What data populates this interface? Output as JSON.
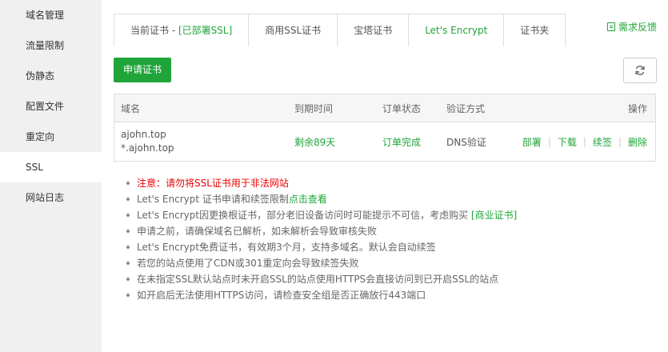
{
  "sidebar": {
    "items": [
      {
        "label": "域名管理"
      },
      {
        "label": "流量限制"
      },
      {
        "label": "伪静态"
      },
      {
        "label": "配置文件"
      },
      {
        "label": "重定向"
      },
      {
        "label": "SSL"
      },
      {
        "label": "网站日志"
      }
    ],
    "active": "SSL"
  },
  "tabs": {
    "current_prefix": "当前证书 - ",
    "current_status": "[已部署SSL]",
    "commercial": "商用SSL证书",
    "baota": "宝塔证书",
    "letsencrypt": "Let's Encrypt",
    "folder": "证书夹",
    "active": "Let's Encrypt"
  },
  "feedback": {
    "label": "需求反馈",
    "icon": "form-icon"
  },
  "toolbar": {
    "apply_label": "申请证书",
    "refresh_icon": "refresh-icon"
  },
  "table": {
    "headers": {
      "domain": "域名",
      "expire": "到期时间",
      "order_status": "订单状态",
      "verify": "验证方式",
      "actions": "操作"
    },
    "rows": [
      {
        "domain_1": "ajohn.top",
        "domain_2": "*.ajohn.top",
        "expire": "剩余89天",
        "order_status": "订单完成",
        "verify": "DNS验证",
        "actions": {
          "deploy": "部署",
          "download": "下载",
          "renew": "续签",
          "delete": "删除"
        }
      }
    ]
  },
  "tips": {
    "t1": "注意：请勿将SSL证书用于非法网站",
    "t2_text": "Let's Encrypt 证书申请和续签限制",
    "t2_link": "点击查看",
    "t3_text": "Let's Encrypt因更换根证书，部分老旧设备访问时可能提示不可信，考虑购买 ",
    "t3_link": "[商业证书]",
    "t4": "申请之前，请确保域名已解析，如未解析会导致审核失败",
    "t5": "Let's Encrypt免费证书，有效期3个月，支持多域名。默认会自动续签",
    "t6": "若您的站点使用了CDN或301重定向会导致续签失败",
    "t7": "在未指定SSL默认站点时未开启SSL的站点使用HTTPS会直接访问到已开启SSL的站点",
    "t8": "如开启后无法使用HTTPS访问，请检查安全组是否正确放行443端口"
  },
  "colors": {
    "accent": "#20a53a",
    "warning": "#e00000",
    "sidebar_bg": "#f0f0f0"
  }
}
